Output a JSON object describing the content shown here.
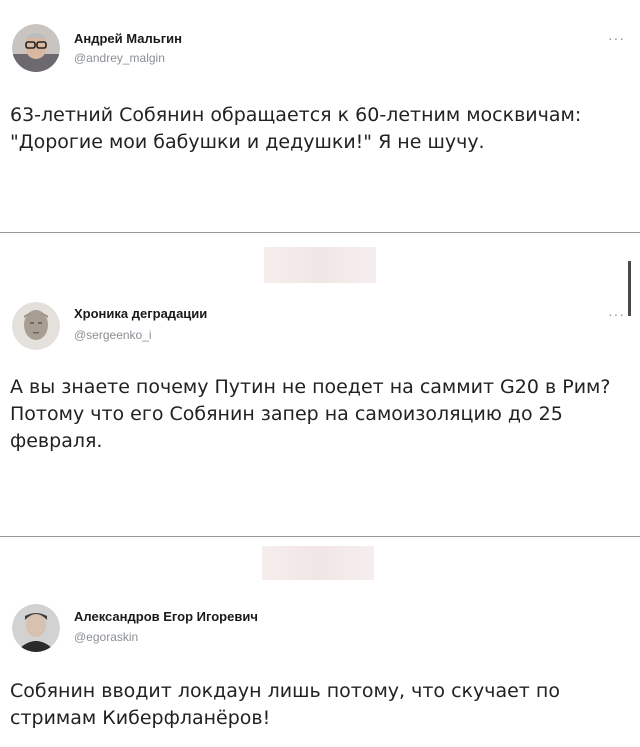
{
  "tweets": [
    {
      "name": "Андрей Мальгин",
      "handle": "@andrey_malgin",
      "text": "63-летний Собянин обращается к 60-летним москвичам: \"Дорогие мои бабушки и дедушки!\" Я не шучу."
    },
    {
      "name": "Хроника деградации",
      "handle": "@sergeenko_i",
      "text": "А вы знаете почему Путин не поедет на саммит G20 в Рим?\nПотому что его Собянин запер на самоизоляцию до 25 февраля."
    },
    {
      "name": "Александров Егор Игоревич",
      "handle": "@egoraskin",
      "text": "Собянин вводит локдаун лишь потому, что скучает по стримам Киберфланёров!"
    }
  ],
  "more_label": "···",
  "icons": [
    "avatar-andrey",
    "avatar-statue",
    "avatar-egor",
    "more-icon"
  ]
}
